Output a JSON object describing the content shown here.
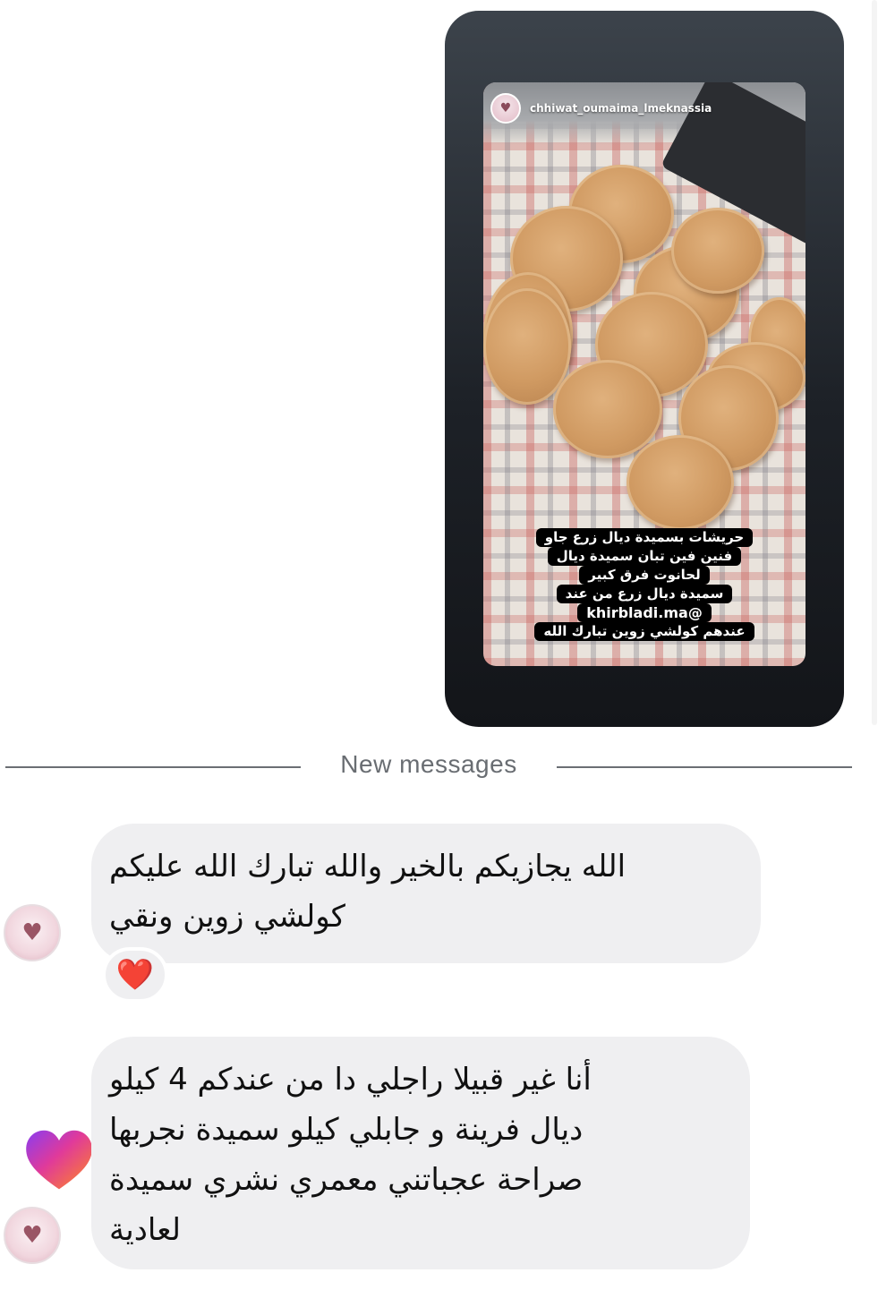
{
  "story": {
    "username": "chhiwat_oumaima_lmeknassia",
    "caption_lines": [
      "حريشات بسميدة ديال زرع جاو",
      "فنين فين تبان سميدة ديال",
      "لحانوت فرق كبير",
      "سميدة ديال زرع من عند",
      "khirbladi.ma@",
      "عندهم كولشي زوين تبارك الله"
    ]
  },
  "divider": {
    "label": "New messages"
  },
  "messages": [
    {
      "lines": [
        "الله يجازيكم بالخير والله تبارك الله عليكم",
        "كولشي زوين ونقي"
      ],
      "reaction": "❤️"
    },
    {
      "lines": [
        "أنا غير قبيلا راجلي دا  من عندكم 4 كيلو",
        "ديال فرينة  و جابلي كيلو سميدة نجربها",
        "صراحة عجباتني معمري نشري سميدة",
        "لعادية"
      ]
    }
  ],
  "icons": {
    "reaction_heart": "red-heart-emoji",
    "sticker": "instagram-heart-sticker",
    "avatar": "profile-avatar"
  },
  "colors": {
    "bubble": "#efeff1",
    "divider": "#6b6f74",
    "reaction_red": "#e0142e"
  }
}
